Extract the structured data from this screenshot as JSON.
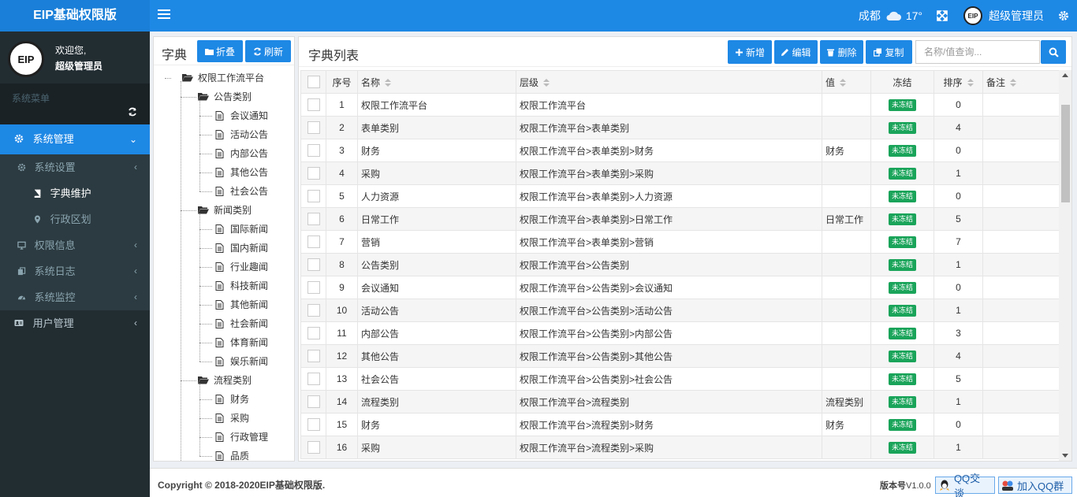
{
  "header": {
    "brand": "EIP基础权限版",
    "city": "成都",
    "temperature": "17°",
    "avatar_text": "EIP",
    "username": "超级管理员"
  },
  "sidebar": {
    "avatar_text": "EIP",
    "welcome": "欢迎您,",
    "user": "超级管理员",
    "menu_header": "系统菜单",
    "items": [
      {
        "label": "系统管理"
      },
      {
        "label": "系统设置"
      },
      {
        "label": "字典维护"
      },
      {
        "label": "行政区划"
      },
      {
        "label": "权限信息"
      },
      {
        "label": "系统日志"
      },
      {
        "label": "系统监控"
      },
      {
        "label": "用户管理"
      }
    ]
  },
  "tree": {
    "title": "字典",
    "fold_label": "折叠",
    "refresh_label": "刷新",
    "root": "权限工作流平台",
    "groups": [
      {
        "label": "公告类别",
        "children": [
          "会议通知",
          "活动公告",
          "内部公告",
          "其他公告",
          "社会公告"
        ]
      },
      {
        "label": "新闻类别",
        "children": [
          "国际新闻",
          "国内新闻",
          "行业趣闻",
          "科技新闻",
          "其他新闻",
          "社会新闻",
          "体育新闻",
          "娱乐新闻"
        ]
      },
      {
        "label": "流程类别",
        "children": [
          "财务",
          "采购",
          "行政管理",
          "品质"
        ]
      }
    ]
  },
  "list": {
    "title": "字典列表",
    "add_label": "新增",
    "edit_label": "编辑",
    "delete_label": "删除",
    "copy_label": "复制",
    "search_placeholder": "名称/值查询...",
    "columns": [
      "序号",
      "名称",
      "层级",
      "值",
      "冻结",
      "排序",
      "备注"
    ],
    "freeze_text": "未冻结",
    "rows": [
      {
        "idx": "1",
        "name": "权限工作流平台",
        "path": "权限工作流平台",
        "value": "",
        "sort": "0",
        "note": ""
      },
      {
        "idx": "2",
        "name": "表单类别",
        "path": "权限工作流平台>表单类别",
        "value": "",
        "sort": "4",
        "note": ""
      },
      {
        "idx": "3",
        "name": "财务",
        "path": "权限工作流平台>表单类别>财务",
        "value": "财务",
        "sort": "0",
        "note": ""
      },
      {
        "idx": "4",
        "name": "采购",
        "path": "权限工作流平台>表单类别>采购",
        "value": "",
        "sort": "1",
        "note": ""
      },
      {
        "idx": "5",
        "name": "人力资源",
        "path": "权限工作流平台>表单类别>人力资源",
        "value": "",
        "sort": "0",
        "note": ""
      },
      {
        "idx": "6",
        "name": "日常工作",
        "path": "权限工作流平台>表单类别>日常工作",
        "value": "日常工作",
        "sort": "5",
        "note": ""
      },
      {
        "idx": "7",
        "name": "营销",
        "path": "权限工作流平台>表单类别>营销",
        "value": "",
        "sort": "7",
        "note": ""
      },
      {
        "idx": "8",
        "name": "公告类别",
        "path": "权限工作流平台>公告类别",
        "value": "",
        "sort": "1",
        "note": ""
      },
      {
        "idx": "9",
        "name": "会议通知",
        "path": "权限工作流平台>公告类别>会议通知",
        "value": "",
        "sort": "0",
        "note": ""
      },
      {
        "idx": "10",
        "name": "活动公告",
        "path": "权限工作流平台>公告类别>活动公告",
        "value": "",
        "sort": "1",
        "note": ""
      },
      {
        "idx": "11",
        "name": "内部公告",
        "path": "权限工作流平台>公告类别>内部公告",
        "value": "",
        "sort": "3",
        "note": ""
      },
      {
        "idx": "12",
        "name": "其他公告",
        "path": "权限工作流平台>公告类别>其他公告",
        "value": "",
        "sort": "4",
        "note": ""
      },
      {
        "idx": "13",
        "name": "社会公告",
        "path": "权限工作流平台>公告类别>社会公告",
        "value": "",
        "sort": "5",
        "note": ""
      },
      {
        "idx": "14",
        "name": "流程类别",
        "path": "权限工作流平台>流程类别",
        "value": "流程类别",
        "sort": "1",
        "note": ""
      },
      {
        "idx": "15",
        "name": "财务",
        "path": "权限工作流平台>流程类别>财务",
        "value": "财务",
        "sort": "0",
        "note": ""
      },
      {
        "idx": "16",
        "name": "采购",
        "path": "权限工作流平台>流程类别>采购",
        "value": "",
        "sort": "1",
        "note": ""
      }
    ]
  },
  "footer": {
    "copyright": "Copyright © 2018-2020EIP基础权限版.",
    "version_label": "版本号",
    "version_value": "V1.0.0",
    "qq_chat": "QQ交谈",
    "qq_group": "加入QQ群"
  },
  "colors": {
    "primary": "#1e88e5",
    "sidebar_bg": "#222d32",
    "badge_green": "#1aa45a"
  }
}
